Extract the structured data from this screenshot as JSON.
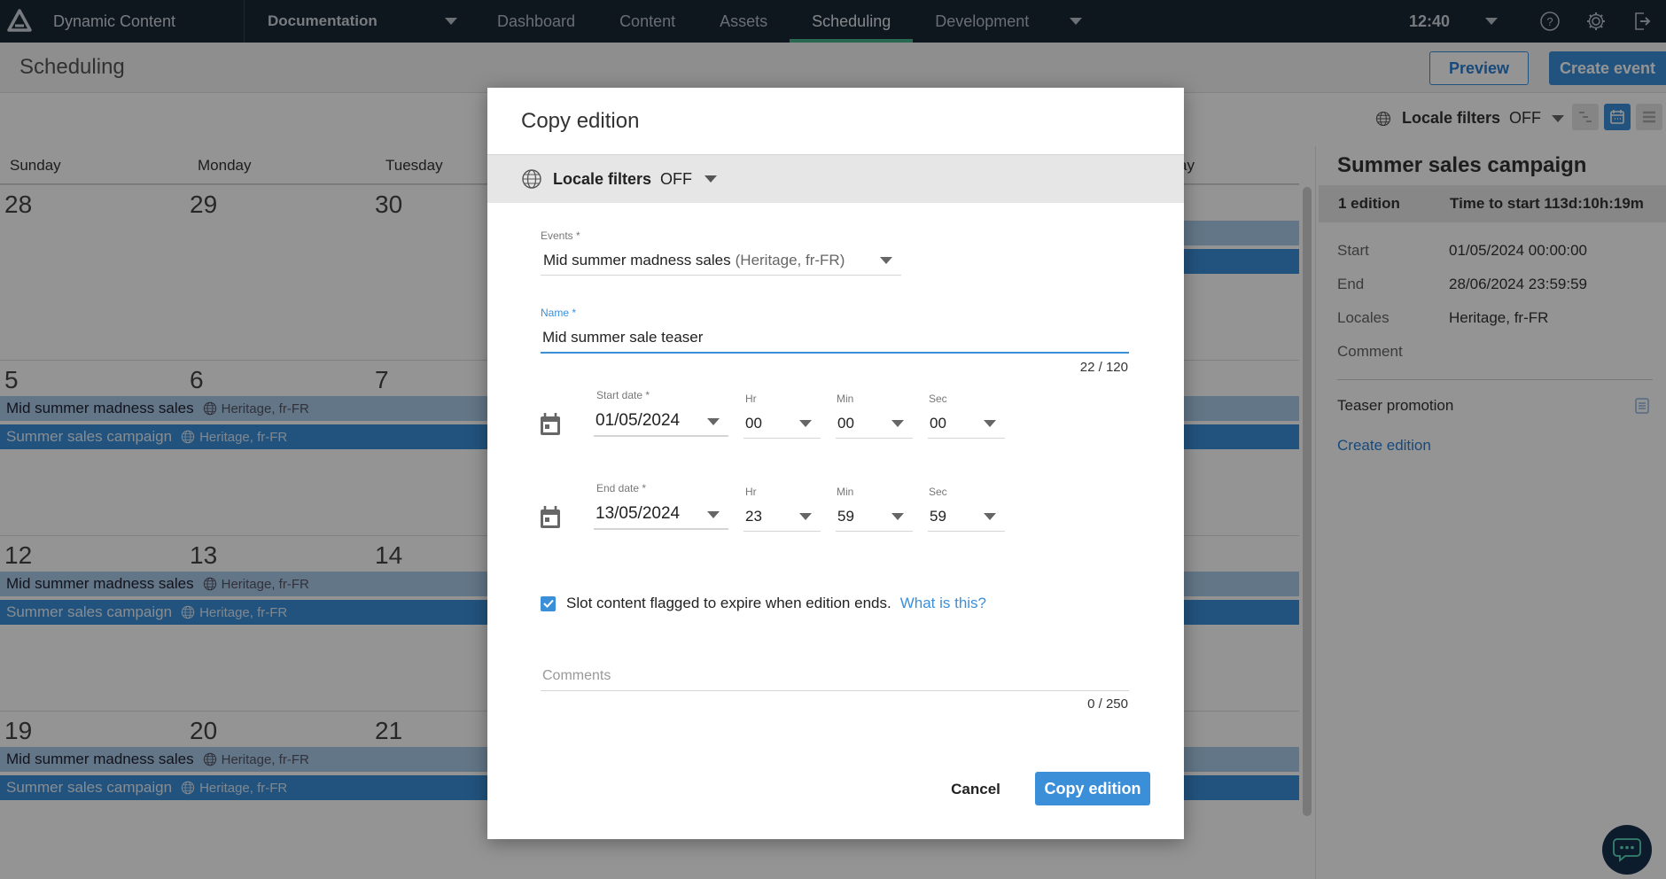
{
  "topnav": {
    "app_name": "Dynamic Content",
    "hub": "Documentation",
    "tabs": [
      {
        "label": "Dashboard",
        "active": false
      },
      {
        "label": "Content",
        "active": false
      },
      {
        "label": "Assets",
        "active": false
      },
      {
        "label": "Scheduling",
        "active": true
      },
      {
        "label": "Development",
        "active": false
      }
    ],
    "clock": "12:40",
    "icons": [
      "help-icon",
      "settings-icon",
      "logout-icon"
    ]
  },
  "subheader": {
    "title": "Scheduling",
    "preview_label": "Preview",
    "create_event_label": "Create event"
  },
  "toolbar": {
    "locale_label": "Locale filters",
    "locale_value": "OFF",
    "views": [
      "timeline-view",
      "calendar-view",
      "list-view"
    ],
    "active_view": "calendar-view"
  },
  "calendar": {
    "day_headers": [
      "Sunday",
      "Monday",
      "Tuesday",
      "",
      "",
      "",
      "ay"
    ],
    "weeks": [
      {
        "days": [
          "28",
          "29",
          "30"
        ],
        "events": []
      },
      {
        "days": [
          "5",
          "6",
          "7"
        ],
        "events": [
          {
            "name": "Mid summer madness sales",
            "locales": "Heritage, fr-FR",
            "style": "light"
          },
          {
            "name": "Summer sales campaign",
            "locales": "Heritage, fr-FR",
            "style": "dark"
          }
        ]
      },
      {
        "days": [
          "12",
          "13",
          "14"
        ],
        "events": [
          {
            "name": "Mid summer madness sales",
            "locales": "Heritage, fr-FR",
            "style": "light"
          },
          {
            "name": "Summer sales campaign",
            "locales": "Heritage, fr-FR",
            "style": "dark"
          }
        ]
      },
      {
        "days": [
          "19",
          "20",
          "21"
        ],
        "events": [
          {
            "name": "Mid summer madness sales",
            "locales": "Heritage, fr-FR",
            "style": "light"
          },
          {
            "name": "Summer sales campaign",
            "locales": "Heritage, fr-FR",
            "style": "dark"
          }
        ]
      }
    ]
  },
  "right_panel": {
    "title": "Summer sales campaign",
    "editions": "1 edition",
    "time_to_start": "Time to start 113d:10h:19m",
    "details": [
      {
        "key": "Start",
        "value": "01/05/2024 00:00:00"
      },
      {
        "key": "End",
        "value": "28/06/2024 23:59:59"
      },
      {
        "key": "Locales",
        "value": "Heritage, fr-FR"
      },
      {
        "key": "Comment",
        "value": ""
      }
    ],
    "edition_name": "Teaser promotion",
    "create_edition_label": "Create edition"
  },
  "dialog": {
    "title": "Copy edition",
    "locale_label": "Locale filters",
    "locale_value": "OFF",
    "events_label": "Events *",
    "events_value": "Mid summer madness sales",
    "events_value_suffix": "(Heritage, fr-FR)",
    "name_label": "Name *",
    "name_value": "Mid summer sale teaser",
    "name_counter": "22 / 120",
    "start": {
      "label": "Start date *",
      "date": "01/05/2024",
      "hr_label": "Hr",
      "hr": "00",
      "min_label": "Min",
      "min": "00",
      "sec_label": "Sec",
      "sec": "00"
    },
    "end": {
      "label": "End date *",
      "date": "13/05/2024",
      "hr_label": "Hr",
      "hr": "23",
      "min_label": "Min",
      "min": "59",
      "sec_label": "Sec",
      "sec": "59"
    },
    "expire_checked": true,
    "expire_label": "Slot content flagged to expire when edition ends.",
    "what_is_this": "What is this?",
    "comments_placeholder": "Comments",
    "comments_value": "",
    "comments_counter": "0 / 250",
    "cancel_label": "Cancel",
    "copy_label": "Copy edition"
  },
  "colors": {
    "nav_bg": "#1b2834",
    "accent": "#3b8fd9",
    "active_tab_indicator": "#46b48a",
    "event_light": "#a9cbe9",
    "event_dark": "#3b8fd9",
    "chat_bg": "#17314d"
  }
}
